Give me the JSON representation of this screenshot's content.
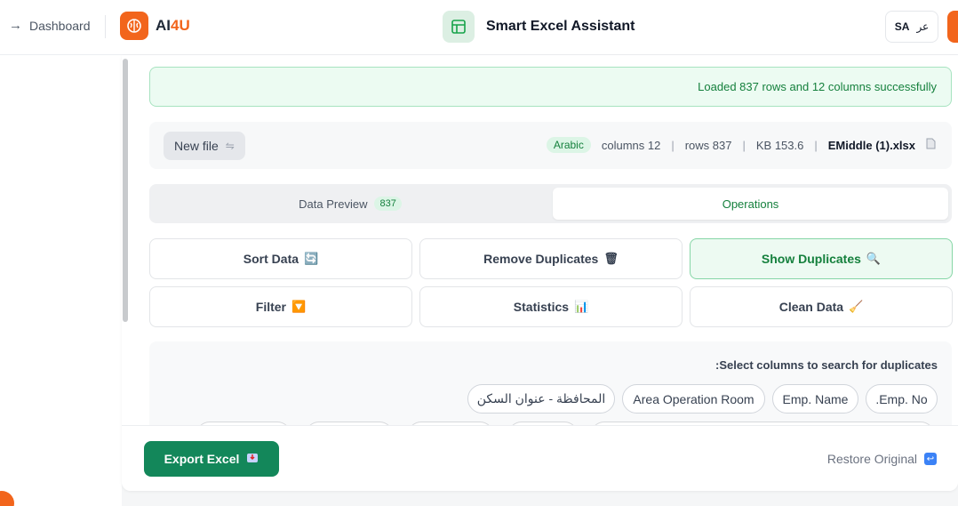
{
  "header": {
    "back_label": "Dashboard",
    "brand_main": "AI",
    "brand_accent": "4U",
    "title": "Smart Excel Assistant",
    "lang_code": "SA",
    "lang_switch": "عر"
  },
  "status": {
    "message": "Loaded 837 rows and 12 columns successfully"
  },
  "file": {
    "new_file_label": "New file",
    "language": "Arabic",
    "columns": "columns 12",
    "rows": "rows 837",
    "size": "KB 153.6",
    "name": "EMiddle (1).xlsx"
  },
  "tabs": {
    "preview_label": "Data Preview",
    "preview_count": "837",
    "operations_label": "Operations",
    "active": "operations"
  },
  "operations": [
    {
      "label": "Sort Data",
      "icon": "🔄",
      "name": "sort-data-button",
      "active": false
    },
    {
      "label": "Remove Duplicates",
      "icon": "🗑",
      "name": "remove-duplicates-button",
      "active": false
    },
    {
      "label": "Show Duplicates",
      "icon": "🔍",
      "name": "show-duplicates-button",
      "active": true
    },
    {
      "label": "Filter",
      "icon": "🔽",
      "name": "filter-button",
      "active": false
    },
    {
      "label": "Statistics",
      "icon": "📊",
      "name": "statistics-button",
      "active": false
    },
    {
      "label": "Clean Data",
      "icon": "🧹",
      "name": "clean-data-button",
      "active": false
    }
  ],
  "duplicates": {
    "prompt": ":Select columns to search for duplicates",
    "columns": [
      "المحافظة - عنوان السكن",
      "Area Operation Room",
      "Emp. Name",
      ".Emp. No"
    ]
  },
  "footer": {
    "export_label": "Export Excel",
    "restore_label": "Restore Original"
  },
  "colors": {
    "brand": "#f2651c",
    "primary_green": "#13875a",
    "success_text": "#15803d"
  }
}
